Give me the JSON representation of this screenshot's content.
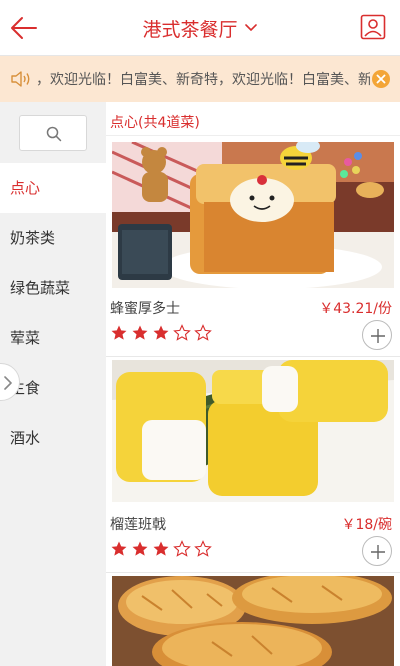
{
  "header": {
    "title": "港式茶餐厅"
  },
  "notice": {
    "text": "，欢迎光临！白富美、新奇特，欢迎光临！白富美、新奇特"
  },
  "sidebar": {
    "categories": [
      {
        "label": "点心",
        "active": true
      },
      {
        "label": "奶茶类",
        "active": false
      },
      {
        "label": "绿色蔬菜",
        "active": false
      },
      {
        "label": "荤菜",
        "active": false
      },
      {
        "label": "主食",
        "active": false
      },
      {
        "label": "酒水",
        "active": false
      }
    ]
  },
  "section": {
    "title": "点心(共4道菜)"
  },
  "dishes": [
    {
      "name": "蜂蜜厚多士",
      "price": "￥43.21/份",
      "rating": 3,
      "max_rating": 5
    },
    {
      "name": "榴莲班戟",
      "price": "￥18/碗",
      "rating": 3,
      "max_rating": 5
    },
    {
      "name": "",
      "price": "",
      "rating": 0,
      "max_rating": 5
    }
  ],
  "colors": {
    "accent": "#d92e2e",
    "notice_bg": "#fce7d2",
    "close_badge": "#f3a537",
    "sidebar_bg": "#f1f1f1"
  }
}
